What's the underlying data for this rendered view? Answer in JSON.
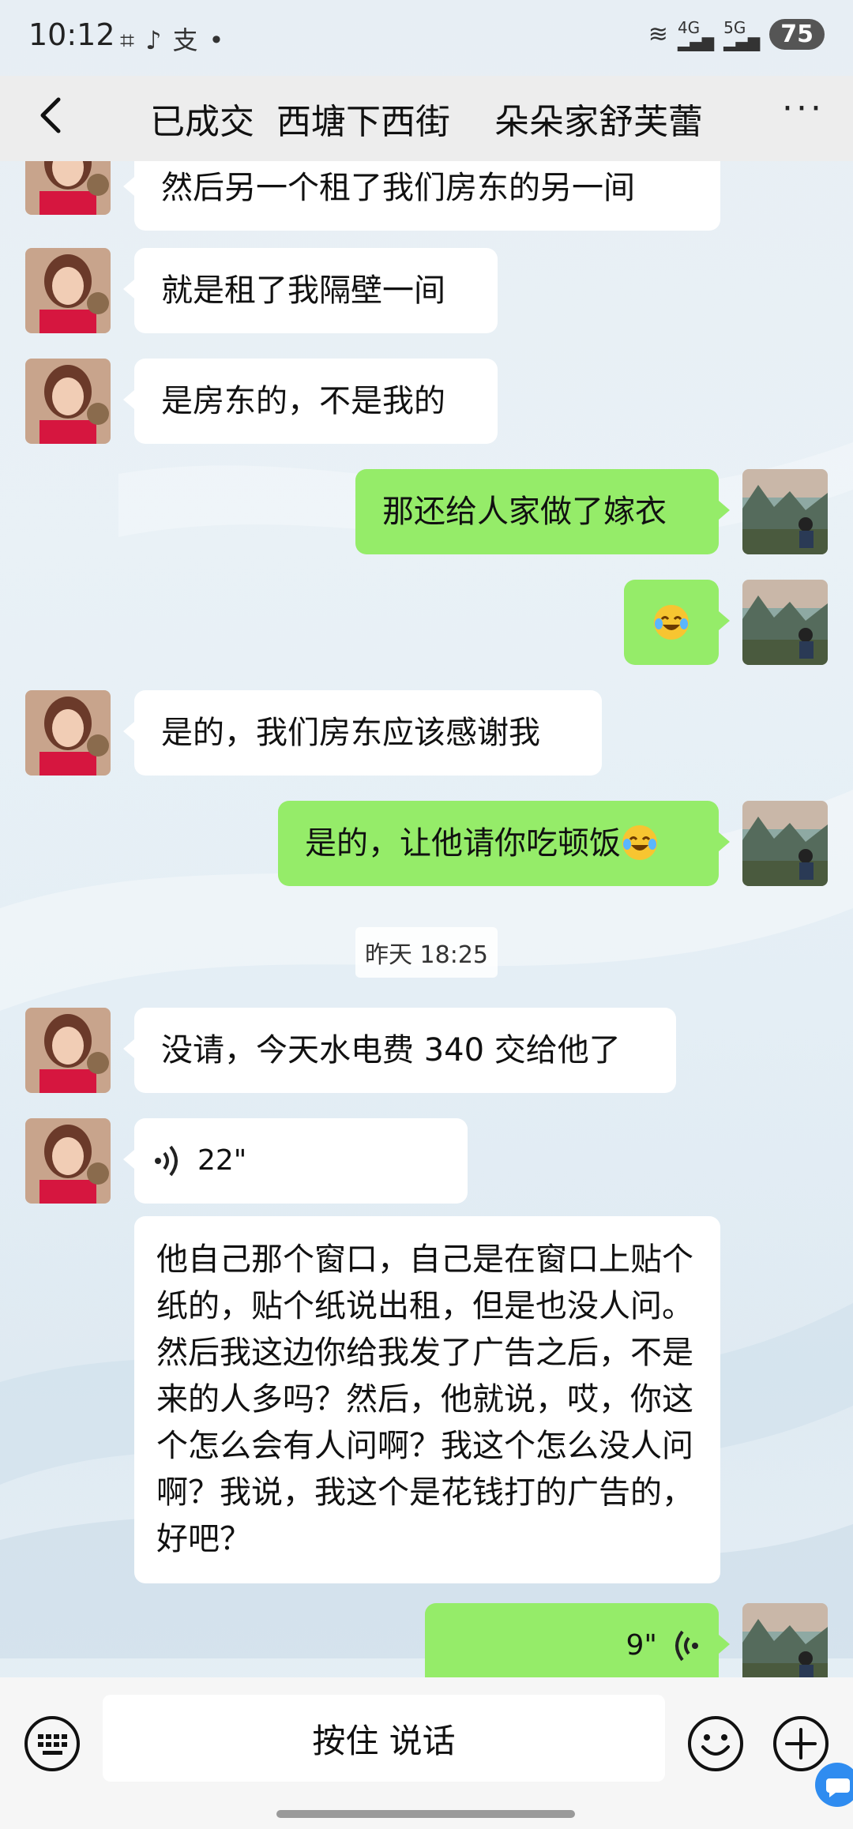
{
  "status_bar": {
    "time": "10:12",
    "left_icons": [
      "scan-icon",
      "tiktok-icon",
      "alipay-icon",
      "dot-icon"
    ],
    "signal_labels": [
      "4G",
      "5G"
    ],
    "battery": "75"
  },
  "header": {
    "title": "已成交  西塘下西街    朵朵家舒芙蕾",
    "back_icon": "chevron-left-icon",
    "more_icon": "more-dots-icon"
  },
  "messages": [
    {
      "side": "left",
      "text": "然后另一个租了我们房东的另一间"
    },
    {
      "side": "left",
      "text": "就是租了我隔壁一间"
    },
    {
      "side": "left",
      "text": "是房东的，不是我的"
    },
    {
      "side": "right",
      "text": "那还给人家做了嫁衣"
    },
    {
      "side": "right",
      "text": "",
      "emoji": "laughing-tears-emoji"
    },
    {
      "side": "left",
      "text": "是的，我们房东应该感谢我"
    },
    {
      "side": "right",
      "text": "是的，让他请你吃顿饭",
      "emoji": "laughing-tears-emoji"
    },
    {
      "type": "timestamp",
      "text": "昨天 18:25"
    },
    {
      "side": "left",
      "text": "没请，今天水电费 340 交给他了"
    },
    {
      "side": "left",
      "type": "voice",
      "duration": "22\""
    },
    {
      "type": "transcript",
      "text": "他自己那个窗口，自己是在窗口上贴个纸的，贴个纸说出租，但是也没人问。然后我这边你给我发了广告之后，不是来的人多吗？然后，他就说，哎，你这个怎么会有人问啊？我这个怎么没人问啊？我说，我这个是花钱打的广告的，好吧？"
    },
    {
      "side": "right",
      "type": "voice",
      "duration": "9\""
    }
  ],
  "input_bar": {
    "hold_to_talk": "按住 说话",
    "keyboard_icon": "keyboard-icon",
    "emoji_icon": "smiley-icon",
    "plus_icon": "plus-circle-icon"
  },
  "colors": {
    "sent_bubble": "#95ec69",
    "received_bubble": "#ffffff",
    "header_bg": "#ededed"
  }
}
